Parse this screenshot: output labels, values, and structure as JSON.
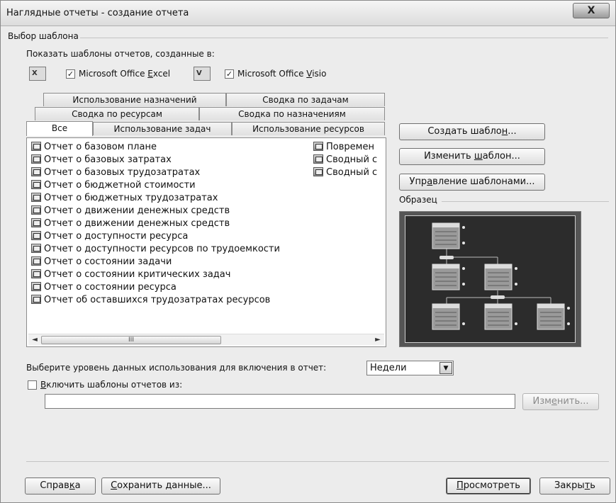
{
  "window": {
    "title": "Наглядные отчеты - создание отчета",
    "close_label": "X"
  },
  "template_group": {
    "label": "Выбор шаблона"
  },
  "show_templates": {
    "label": "Показать шаблоны отчетов, созданные в:",
    "excel": {
      "pre": "Microsoft Office ",
      "key": "E",
      "post": "xcel",
      "checked": true
    },
    "visio": {
      "pre": "Microsoft Office ",
      "key": "V",
      "post": "isio",
      "checked": true
    }
  },
  "tabs": {
    "row1": [
      "Использование назначений",
      "Сводка по задачам"
    ],
    "row2": [
      "Сводка по ресурсам",
      "Сводка по назначениям"
    ],
    "row3": [
      "Все",
      "Использование задач",
      "Использование ресурсов"
    ],
    "active": "Все"
  },
  "reports_col1": [
    "Отчет о базовом плане",
    "Отчет о базовых затратах",
    "Отчет о базовых трудозатратах",
    "Отчет о бюджетной стоимости",
    "Отчет о бюджетных трудозатратах",
    "Отчет о движении денежных средств",
    "Отчет о движении денежных средств",
    "Отчет о доступности ресурса",
    "Отчет о доступности ресурсов по трудоемкости",
    "Отчет о состоянии задачи",
    "Отчет о состоянии критических задач",
    "Отчет о состоянии ресурса",
    "Отчет об оставшихся трудозатратах ресурсов"
  ],
  "reports_col2": [
    "Повремен",
    "Сводный с",
    "Сводный с"
  ],
  "scrollbar": {
    "left": "◄",
    "thumb": "III",
    "right": "►"
  },
  "buttons": {
    "create": {
      "pre": "Создать шабло",
      "key": "н",
      "post": "..."
    },
    "edit": {
      "pre": "Изменить ",
      "key": "ш",
      "post": "аблон..."
    },
    "manage": {
      "pre": "Упр",
      "key": "а",
      "post": "вление шаблонами..."
    },
    "modify": {
      "pre": "Изм",
      "key": "е",
      "post": "нить..."
    },
    "help": {
      "pre": "Справ",
      "key": "к",
      "post": "а"
    },
    "save": {
      "pre": "",
      "key": "С",
      "post": "охранить данные..."
    },
    "view": {
      "pre": "",
      "key": "П",
      "post": "росмотреть"
    },
    "close": {
      "pre": "Закры",
      "key": "т",
      "post": "ь"
    }
  },
  "sample": {
    "label": "Образец"
  },
  "usage_level": {
    "label": "Выберите уровень данных использования для включения в отчет:",
    "value": "Недели"
  },
  "include_templates": {
    "pre": "",
    "key": "В",
    "post": "ключить шаблоны отчетов из:",
    "checked": false,
    "path": ""
  }
}
